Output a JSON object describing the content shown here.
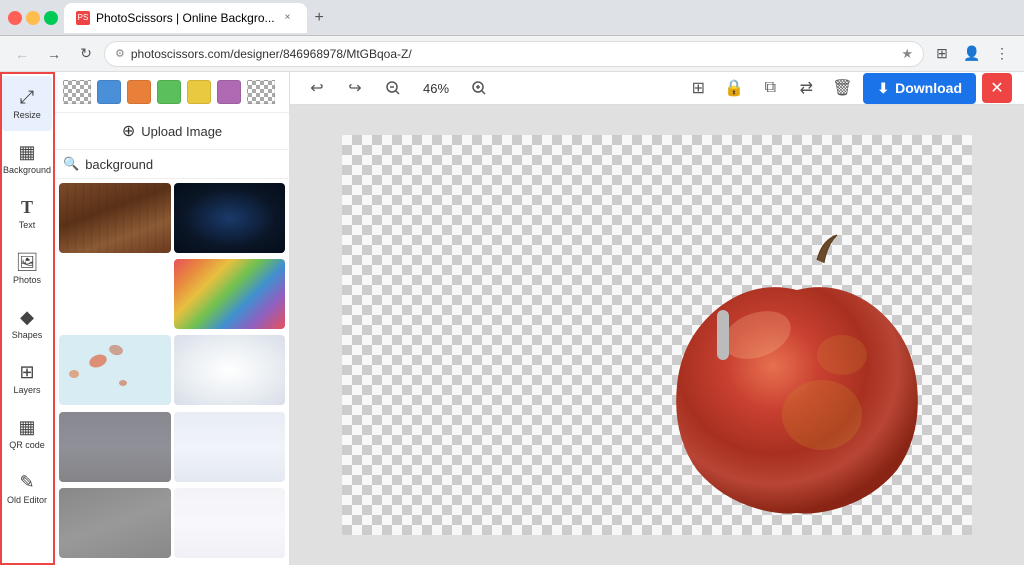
{
  "browser": {
    "tab_title": "PhotoScissors | Online Backgro...",
    "tab_favicon": "PS",
    "url": "photoscissors.com/designer/846968978/MtGBqoa-Z/",
    "new_tab_label": "+"
  },
  "toolbar": {
    "undo_label": "↩",
    "redo_label": "↪",
    "zoom_out_label": "−",
    "zoom_level": "46%",
    "zoom_in_label": "+",
    "layers_label": "⊞",
    "lock_label": "🔒",
    "copy_label": "⧉",
    "trash_label": "🗑",
    "download_label": "Download",
    "close_label": "✕"
  },
  "panel": {
    "upload_label": "Upload Image",
    "search_placeholder": "background",
    "search_icon": "🔍"
  },
  "tools": [
    {
      "id": "resize",
      "icon": "⤢",
      "label": "Resize"
    },
    {
      "id": "background",
      "icon": "▦",
      "label": "Background"
    },
    {
      "id": "text",
      "icon": "T",
      "label": "Text"
    },
    {
      "id": "photos",
      "icon": "🖼",
      "label": "Photos"
    },
    {
      "id": "shapes",
      "icon": "◆",
      "label": "Shapes"
    },
    {
      "id": "layers",
      "icon": "⊞",
      "label": "Layers"
    },
    {
      "id": "qrcode",
      "icon": "▦",
      "label": "QR code"
    },
    {
      "id": "oldeditor",
      "icon": "✎",
      "label": "Old Editor"
    }
  ],
  "colors": [
    {
      "name": "blue",
      "hex": "#4a90d9"
    },
    {
      "name": "orange",
      "hex": "#e87d3f"
    },
    {
      "name": "green",
      "hex": "#5bbf5b"
    },
    {
      "name": "yellow",
      "hex": "#e8c93f"
    },
    {
      "name": "purple",
      "hex": "#b06ab3"
    }
  ],
  "backgrounds": [
    {
      "id": 1,
      "type": "wood",
      "color": "#6b3a2a"
    },
    {
      "id": 2,
      "type": "dark-space",
      "color": "#0a2040"
    },
    {
      "id": 3,
      "type": "light-gray",
      "color": "#c8c8cc"
    },
    {
      "id": 4,
      "type": "colorful-stripes",
      "color": "#e0803a"
    },
    {
      "id": 5,
      "type": "splatter",
      "color": "#d0e8f0"
    },
    {
      "id": 6,
      "type": "white-light",
      "color": "#f0f4f8"
    },
    {
      "id": 7,
      "type": "gray-texture",
      "color": "#b0b0b8"
    },
    {
      "id": 8,
      "type": "white-subtle",
      "color": "#e8ecf0"
    },
    {
      "id": 9,
      "type": "dark-gray",
      "color": "#888890"
    },
    {
      "id": 10,
      "type": "very-light",
      "color": "#f4f4f8"
    }
  ]
}
